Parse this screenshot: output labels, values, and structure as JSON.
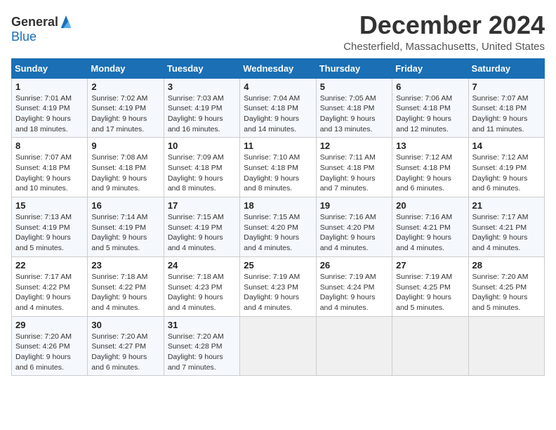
{
  "header": {
    "logo": {
      "general": "General",
      "blue": "Blue"
    },
    "title": "December 2024",
    "location": "Chesterfield, Massachusetts, United States"
  },
  "weekdays": [
    "Sunday",
    "Monday",
    "Tuesday",
    "Wednesday",
    "Thursday",
    "Friday",
    "Saturday"
  ],
  "weeks": [
    [
      {
        "day": "1",
        "sunrise": "7:01 AM",
        "sunset": "4:19 PM",
        "daylight": "9 hours and 18 minutes."
      },
      {
        "day": "2",
        "sunrise": "7:02 AM",
        "sunset": "4:19 PM",
        "daylight": "9 hours and 17 minutes."
      },
      {
        "day": "3",
        "sunrise": "7:03 AM",
        "sunset": "4:19 PM",
        "daylight": "9 hours and 16 minutes."
      },
      {
        "day": "4",
        "sunrise": "7:04 AM",
        "sunset": "4:18 PM",
        "daylight": "9 hours and 14 minutes."
      },
      {
        "day": "5",
        "sunrise": "7:05 AM",
        "sunset": "4:18 PM",
        "daylight": "9 hours and 13 minutes."
      },
      {
        "day": "6",
        "sunrise": "7:06 AM",
        "sunset": "4:18 PM",
        "daylight": "9 hours and 12 minutes."
      },
      {
        "day": "7",
        "sunrise": "7:07 AM",
        "sunset": "4:18 PM",
        "daylight": "9 hours and 11 minutes."
      }
    ],
    [
      {
        "day": "8",
        "sunrise": "7:07 AM",
        "sunset": "4:18 PM",
        "daylight": "9 hours and 10 minutes."
      },
      {
        "day": "9",
        "sunrise": "7:08 AM",
        "sunset": "4:18 PM",
        "daylight": "9 hours and 9 minutes."
      },
      {
        "day": "10",
        "sunrise": "7:09 AM",
        "sunset": "4:18 PM",
        "daylight": "9 hours and 8 minutes."
      },
      {
        "day": "11",
        "sunrise": "7:10 AM",
        "sunset": "4:18 PM",
        "daylight": "9 hours and 8 minutes."
      },
      {
        "day": "12",
        "sunrise": "7:11 AM",
        "sunset": "4:18 PM",
        "daylight": "9 hours and 7 minutes."
      },
      {
        "day": "13",
        "sunrise": "7:12 AM",
        "sunset": "4:18 PM",
        "daylight": "9 hours and 6 minutes."
      },
      {
        "day": "14",
        "sunrise": "7:12 AM",
        "sunset": "4:19 PM",
        "daylight": "9 hours and 6 minutes."
      }
    ],
    [
      {
        "day": "15",
        "sunrise": "7:13 AM",
        "sunset": "4:19 PM",
        "daylight": "9 hours and 5 minutes."
      },
      {
        "day": "16",
        "sunrise": "7:14 AM",
        "sunset": "4:19 PM",
        "daylight": "9 hours and 5 minutes."
      },
      {
        "day": "17",
        "sunrise": "7:15 AM",
        "sunset": "4:19 PM",
        "daylight": "9 hours and 4 minutes."
      },
      {
        "day": "18",
        "sunrise": "7:15 AM",
        "sunset": "4:20 PM",
        "daylight": "9 hours and 4 minutes."
      },
      {
        "day": "19",
        "sunrise": "7:16 AM",
        "sunset": "4:20 PM",
        "daylight": "9 hours and 4 minutes."
      },
      {
        "day": "20",
        "sunrise": "7:16 AM",
        "sunset": "4:21 PM",
        "daylight": "9 hours and 4 minutes."
      },
      {
        "day": "21",
        "sunrise": "7:17 AM",
        "sunset": "4:21 PM",
        "daylight": "9 hours and 4 minutes."
      }
    ],
    [
      {
        "day": "22",
        "sunrise": "7:17 AM",
        "sunset": "4:22 PM",
        "daylight": "9 hours and 4 minutes."
      },
      {
        "day": "23",
        "sunrise": "7:18 AM",
        "sunset": "4:22 PM",
        "daylight": "9 hours and 4 minutes."
      },
      {
        "day": "24",
        "sunrise": "7:18 AM",
        "sunset": "4:23 PM",
        "daylight": "9 hours and 4 minutes."
      },
      {
        "day": "25",
        "sunrise": "7:19 AM",
        "sunset": "4:23 PM",
        "daylight": "9 hours and 4 minutes."
      },
      {
        "day": "26",
        "sunrise": "7:19 AM",
        "sunset": "4:24 PM",
        "daylight": "9 hours and 4 minutes."
      },
      {
        "day": "27",
        "sunrise": "7:19 AM",
        "sunset": "4:25 PM",
        "daylight": "9 hours and 5 minutes."
      },
      {
        "day": "28",
        "sunrise": "7:20 AM",
        "sunset": "4:25 PM",
        "daylight": "9 hours and 5 minutes."
      }
    ],
    [
      {
        "day": "29",
        "sunrise": "7:20 AM",
        "sunset": "4:26 PM",
        "daylight": "9 hours and 6 minutes."
      },
      {
        "day": "30",
        "sunrise": "7:20 AM",
        "sunset": "4:27 PM",
        "daylight": "9 hours and 6 minutes."
      },
      {
        "day": "31",
        "sunrise": "7:20 AM",
        "sunset": "4:28 PM",
        "daylight": "9 hours and 7 minutes."
      },
      null,
      null,
      null,
      null
    ]
  ],
  "labels": {
    "sunrise": "Sunrise:",
    "sunset": "Sunset:",
    "daylight": "Daylight:"
  }
}
